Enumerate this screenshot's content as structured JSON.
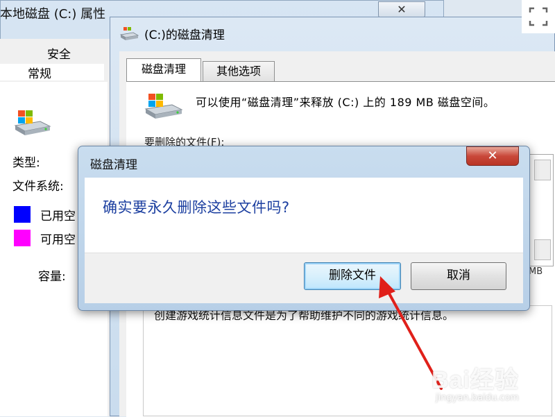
{
  "properties_window": {
    "title": "本地磁盘 (C:) 属性",
    "close_glyph": "✕",
    "tabs": {
      "security": "安全",
      "general": "常规"
    },
    "labels": {
      "type": "类型:",
      "filesystem": "文件系统:",
      "used": "已用空",
      "free": "可用空",
      "capacity": "容量:"
    },
    "colors": {
      "used": "#0000ff",
      "free": "#ff00ff"
    }
  },
  "cleanup_window": {
    "title": "(C:)的磁盘清理",
    "tabs": {
      "cleanup": "磁盘清理",
      "options": "其他选项"
    },
    "description": "可以使用“磁盘清理”来释放 (C:) 上的 189 MB 磁盘空间。",
    "files_label": "要删除的文件(F):",
    "size_text": "MB",
    "file_description": "创建游戏统计信息文件是为了帮助维护不同的游戏统计信息。"
  },
  "dialog": {
    "title": "磁盘清理",
    "close_glyph": "✕",
    "message": "确实要永久删除这些文件吗?",
    "buttons": {
      "delete": "删除文件",
      "cancel": "取消"
    },
    "accent_color": "#1c3fa0"
  },
  "annotation": {
    "arrow_color": "#e0201a"
  },
  "watermark": {
    "brand": "Bai经验",
    "url": "jingyan.baidu.com"
  }
}
